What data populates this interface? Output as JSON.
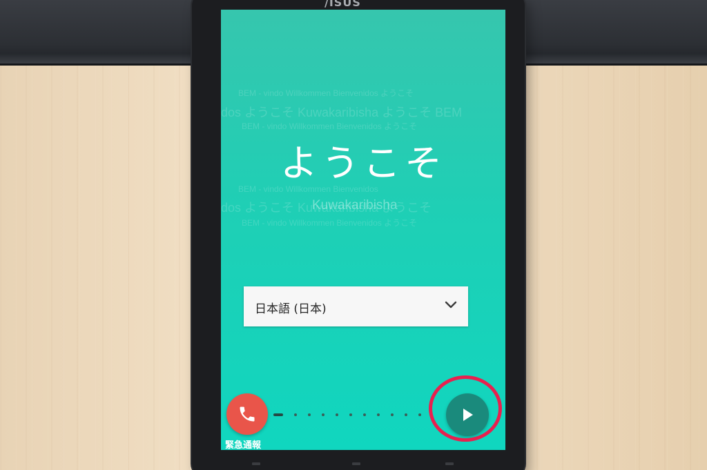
{
  "device": {
    "brand": "/ISUS"
  },
  "welcome": {
    "title": "ようこそ",
    "background_lines": [
      "BEM - vindo Willkommen Bienvenidos ようこそ",
      "dos ようこそ Kuwakaribisha ようこそ BEM",
      "BEM - vindo Willkommen Bienvenidos ようこそ",
      "BEM - vindo Willkommen Bienvenidos",
      "dos ようこそ Kuwakaribisha ようこそ",
      "BEM - vindo Willkommen Bienvenidos ようこそ"
    ],
    "highlight_word": "Kuwakaribisha"
  },
  "language_select": {
    "value": "日本語 (日本)",
    "icon": "chevron-down-icon"
  },
  "emergency": {
    "label": "緊急通報",
    "icon": "phone-icon",
    "color": "#e9554a"
  },
  "next_button": {
    "icon": "play-arrow-icon",
    "color": "#1a8a7c"
  },
  "annotation": {
    "ring_color": "#e8204f"
  },
  "theme": {
    "screen_color": "#1fcfb5"
  }
}
